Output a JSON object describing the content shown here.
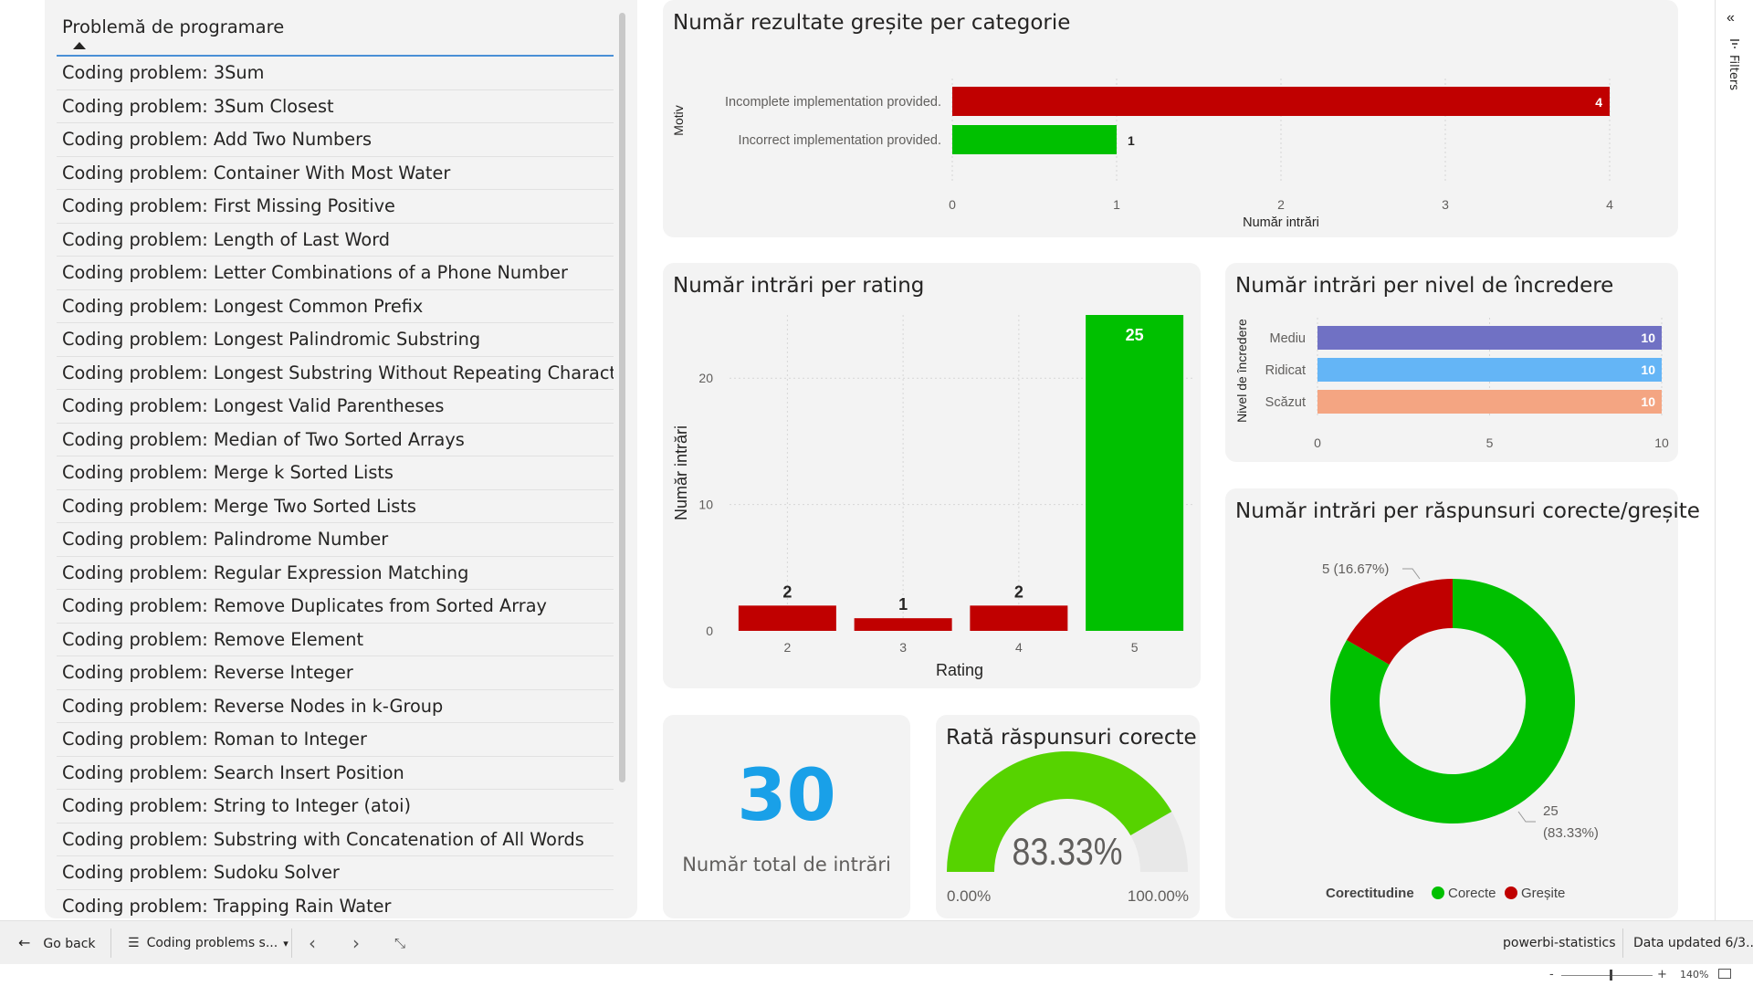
{
  "slicer": {
    "header": "Problemă de programare",
    "items": [
      "Coding problem: 3Sum",
      "Coding problem: 3Sum Closest",
      "Coding problem: Add Two Numbers",
      "Coding problem: Container With Most Water",
      "Coding problem: First Missing Positive",
      "Coding problem: Length of Last Word",
      "Coding problem: Letter Combinations of a Phone Number",
      "Coding problem: Longest Common Prefix",
      "Coding problem: Longest Palindromic Substring",
      "Coding problem: Longest Substring Without Repeating Characters",
      "Coding problem: Longest Valid Parentheses",
      "Coding problem: Median of Two Sorted Arrays",
      "Coding problem: Merge k Sorted Lists",
      "Coding problem: Merge Two Sorted Lists",
      "Coding problem: Palindrome Number",
      "Coding problem: Regular Expression Matching",
      "Coding problem: Remove Duplicates from Sorted Array",
      "Coding problem: Remove Element",
      "Coding problem: Reverse Integer",
      "Coding problem: Reverse Nodes in k-Group",
      "Coding problem: Roman to Integer",
      "Coding problem: Search Insert Position",
      "Coding problem: String to Integer (atoi)",
      "Coding problem: Substring with Concatenation of All Words",
      "Coding problem: Sudoku Solver",
      "Coding problem: Trapping Rain Water"
    ]
  },
  "chart_data": [
    {
      "id": "wrong",
      "type": "bar",
      "orientation": "horizontal",
      "title": "Număr rezultate greșite per categorie",
      "xlabel": "Număr intrări",
      "ylabel": "Motiv",
      "categories": [
        "Incomplete implementation provided.",
        "Incorrect implementation provided."
      ],
      "values": [
        4,
        1
      ],
      "colors": [
        "#c00000",
        "#00c000"
      ],
      "xlim": [
        0,
        4
      ],
      "xticks": [
        "0",
        "1",
        "2",
        "3",
        "4"
      ],
      "grid": true
    },
    {
      "id": "rating",
      "type": "bar",
      "orientation": "vertical",
      "title": "Număr intrări per rating",
      "xlabel": "Rating",
      "ylabel": "Număr intrări",
      "categories": [
        "2",
        "3",
        "4",
        "5"
      ],
      "values": [
        2,
        1,
        2,
        25
      ],
      "colors": [
        "#c00000",
        "#c00000",
        "#c00000",
        "#00c000"
      ],
      "ylim": [
        0,
        25
      ],
      "yticks": [
        "0",
        "10",
        "20"
      ],
      "grid": true
    },
    {
      "id": "trust",
      "type": "bar",
      "orientation": "horizontal",
      "title": "Număr intrări per nivel de încredere",
      "ylabel": "Nivel de încredere",
      "categories": [
        "Mediu",
        "Ridicat",
        "Scăzut"
      ],
      "values": [
        10,
        10,
        10
      ],
      "colors": [
        "#7071c4",
        "#64b5f6",
        "#f4a582"
      ],
      "xlim": [
        0,
        10
      ],
      "xticks": [
        "0",
        "5",
        "10"
      ],
      "grid": true
    },
    {
      "id": "donut",
      "type": "pie",
      "title": "Număr intrări per răspunsuri corecte/greșite",
      "legend_title": "Corectitudine",
      "legend_position": "bottom",
      "slices": [
        {
          "name": "Corecte",
          "value": 25,
          "label_value": "25",
          "label_pct": "(83.33%)",
          "color": "#00c000"
        },
        {
          "name": "Greșite",
          "value": 5,
          "label": "5 (16.67%)",
          "color": "#c00000"
        }
      ]
    }
  ],
  "kpi": {
    "value": "30",
    "label": "Număr total de intrări",
    "color": "#19a0e8"
  },
  "gauge": {
    "title": "Rată răspunsuri corecte",
    "value": 0.8333,
    "value_label": "83.33%",
    "min_label": "0.00%",
    "max_label": "100.00%",
    "color": "#56d300"
  },
  "footer": {
    "back": "Go back",
    "page": "Coding problems s...",
    "workspace": "powerbi-statistics",
    "updated": "Data updated 6/3..."
  },
  "status": {
    "zoom": "140%",
    "minus": "-",
    "plus": "+"
  },
  "filters": {
    "label": "Filters"
  }
}
